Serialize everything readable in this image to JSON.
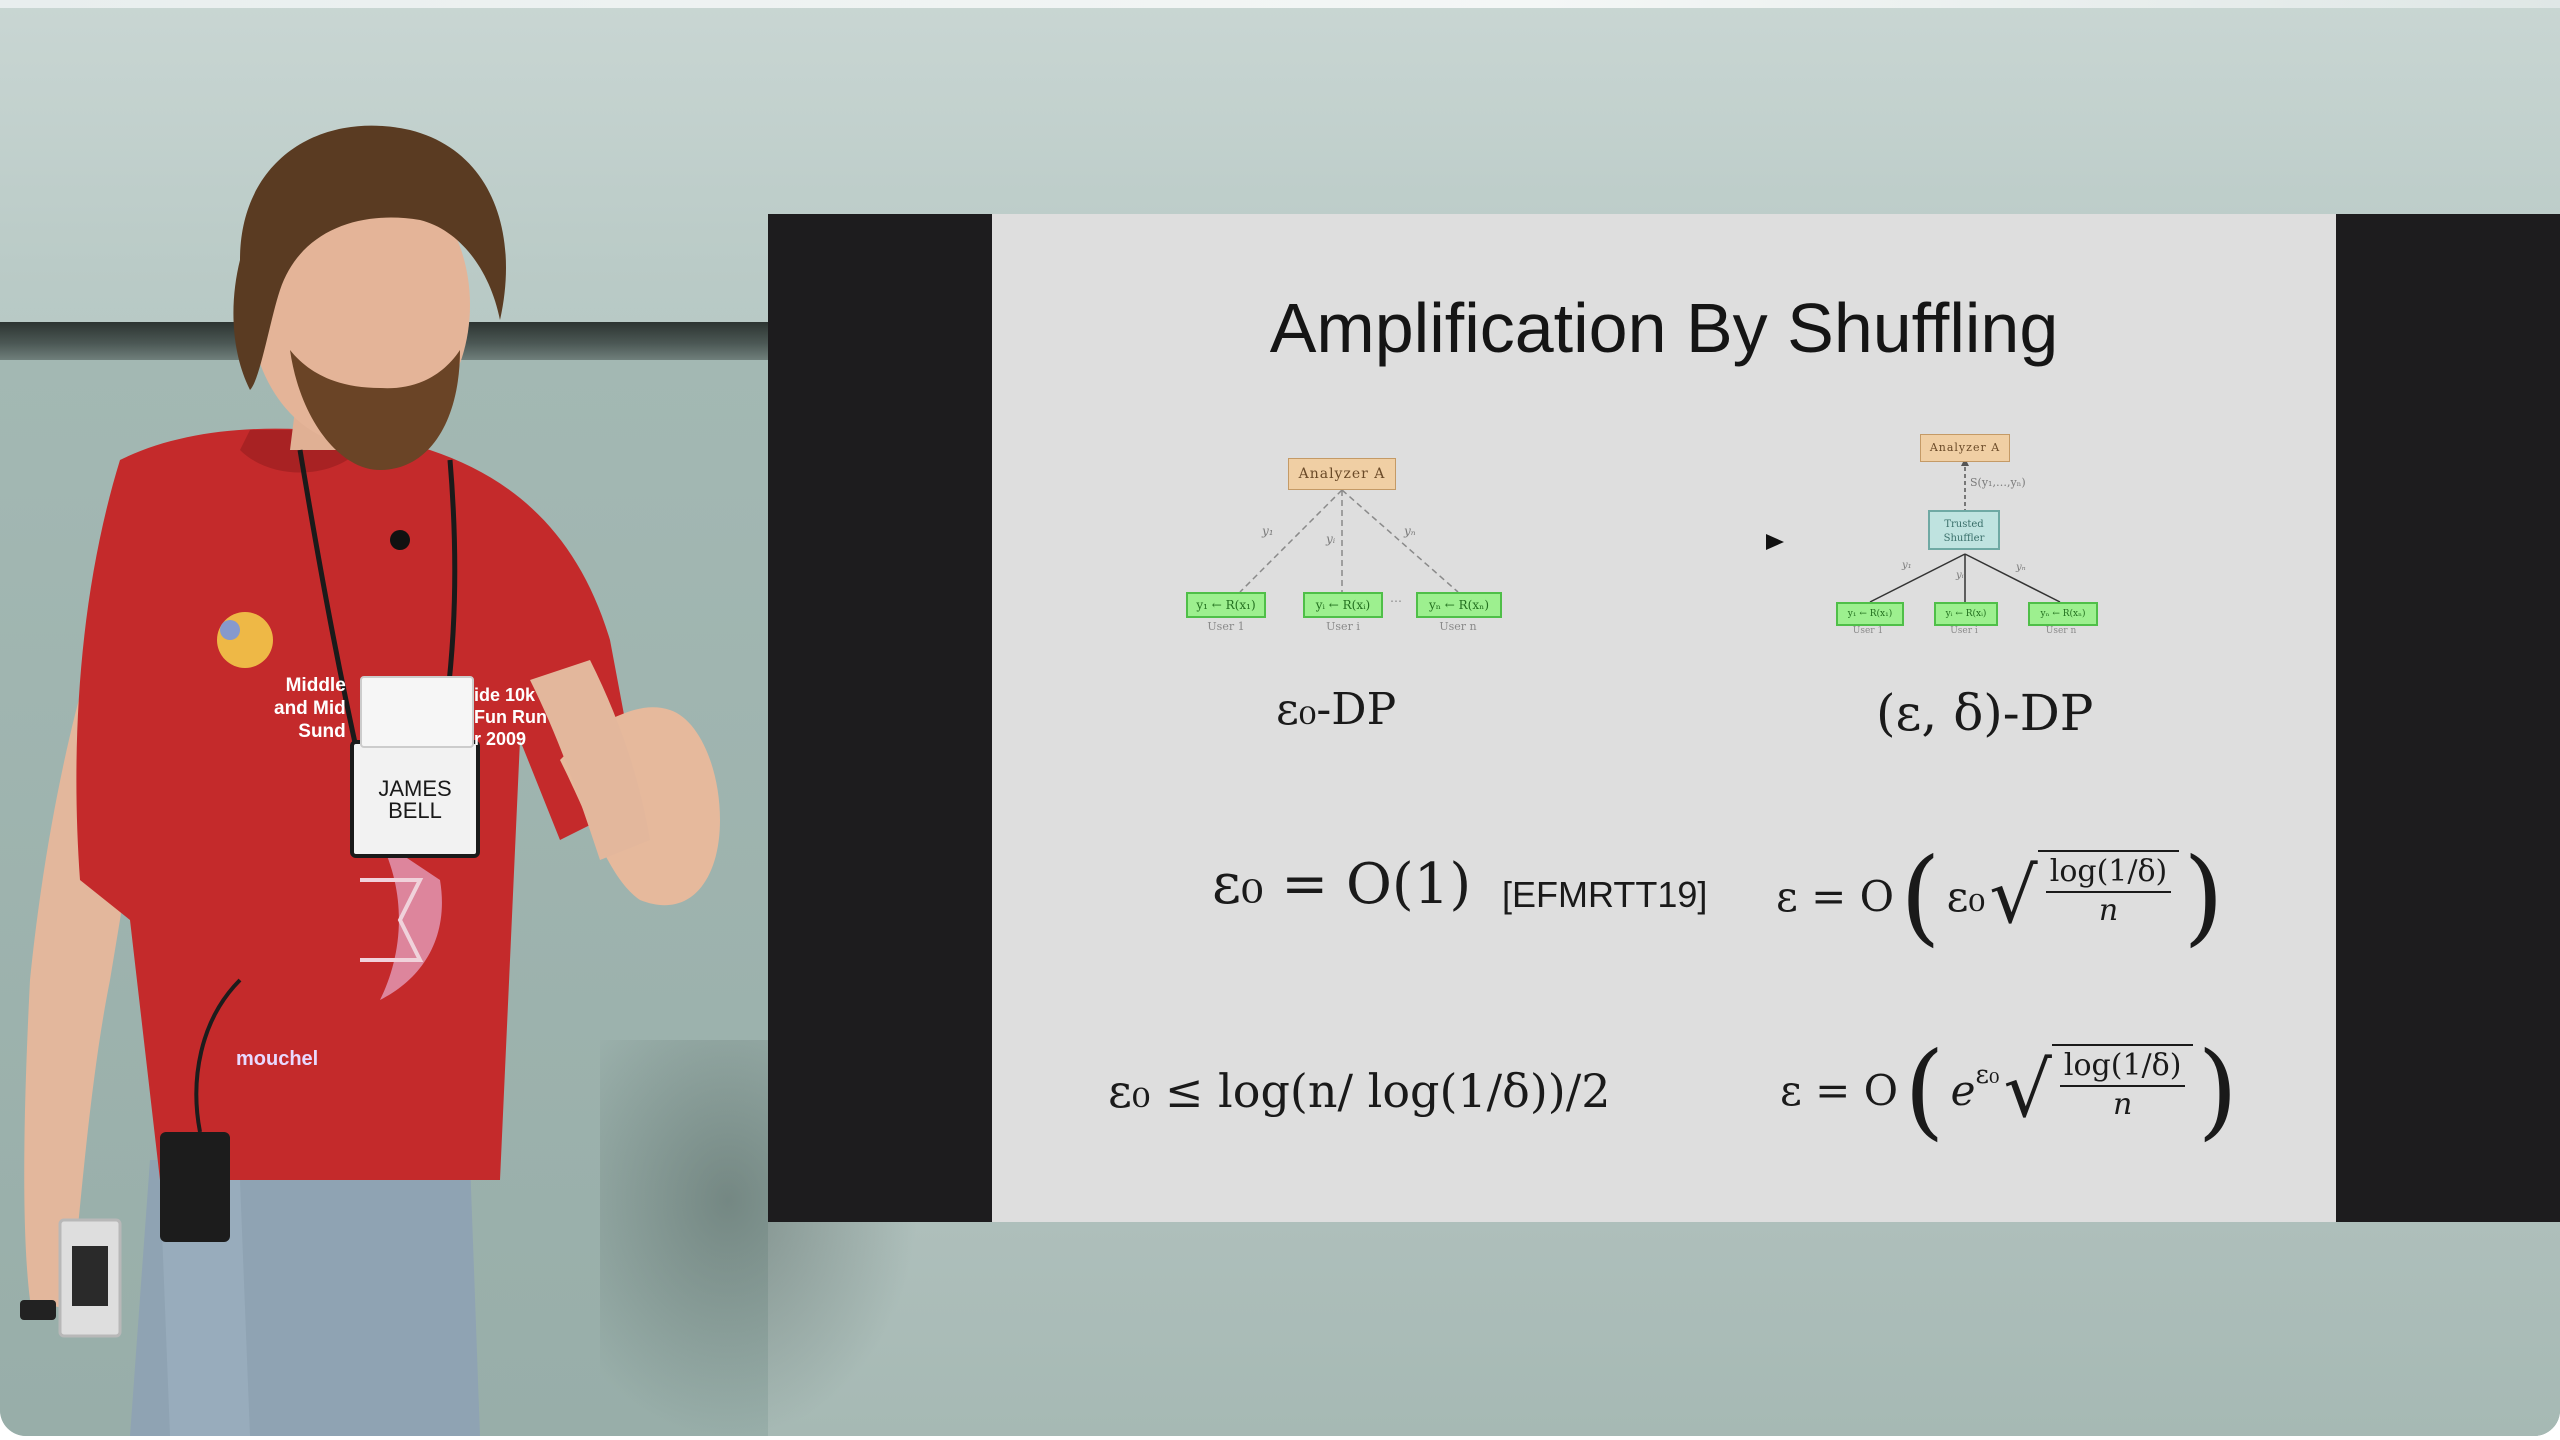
{
  "slide": {
    "title": "Amplification By Shuffling",
    "local_label": "ε₀-DP",
    "shuffle_label": "(ε, δ)-DP",
    "row1_left": "ε₀ = O(1)",
    "row1_cite": "[EFMRTT19]",
    "row1_right_pre": "ε = O",
    "row1_right_factor": "ε₀",
    "row1_right_num": "log(1/δ)",
    "row1_right_den": "n",
    "row2_left": "ε₀ ≤ log(n/ log(1/δ))/2",
    "row2_right_pre": "ε = O",
    "row2_right_factor": "e",
    "row2_right_exp": "ε₀",
    "row2_right_num": "log(1/δ)",
    "row2_right_den": "n"
  },
  "diagram_left": {
    "analyzer": "Analyzer A",
    "users": [
      "y₁ ← R(x₁)",
      "yᵢ ← R(xᵢ)",
      "yₙ ← R(xₙ)"
    ],
    "user_captions": [
      "User 1",
      "User i",
      "User n"
    ],
    "edge_labels": [
      "y₁",
      "yᵢ",
      "yₙ"
    ]
  },
  "diagram_right": {
    "analyzer": "Analyzer A",
    "shuffler_line1": "Trusted",
    "shuffler_line2": "Shuffler",
    "shuffled_label": "S(y₁,…,yₙ)",
    "users": [
      "y₁ ← R(x₁)",
      "yᵢ ← R(xᵢ)",
      "yₙ ← R(xₙ)"
    ],
    "user_captions": [
      "User 1",
      "User i",
      "User n"
    ],
    "edge_labels": [
      "y₁",
      "yᵢ",
      "yₙ"
    ]
  },
  "badge": {
    "name_line1": "JAMES",
    "name_line2": "BELL"
  },
  "shirt": {
    "line1": "Middle",
    "line1b": "ide 10k",
    "line2": "and Mid",
    "line2b": "Fun Run",
    "line3": "Sund",
    "line3b": "r 2009",
    "sponsor": "mouchel"
  },
  "colors": {
    "wall": "#a9bcb8",
    "slide_bg": "#dedede",
    "projection_border": "#1d1c1e",
    "shirt": "#c42a2b",
    "analyzer_box": "#f0cfa4",
    "user_box": "#9df08f",
    "shuffler_box": "#bfe3e0"
  }
}
